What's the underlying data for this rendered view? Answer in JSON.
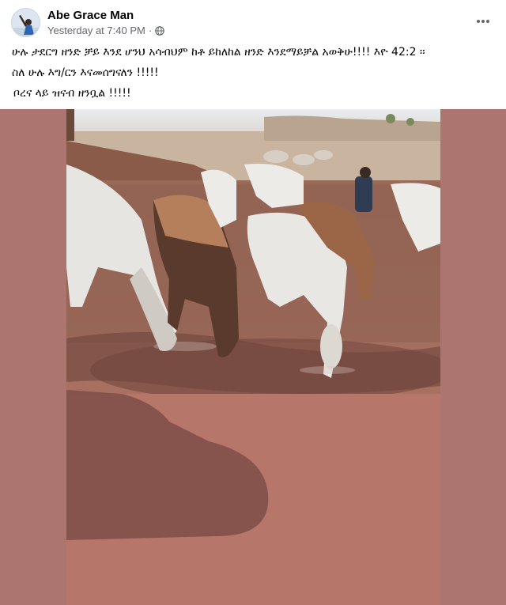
{
  "post": {
    "author": "Abe Grace Man",
    "timestamp": "Yesterday at 7:40 PM",
    "separator": "·",
    "privacy_icon": "globe-icon",
    "more_icon": "more-horizontal-icon",
    "text_lines": [
      "ሁሉ ታደርግ ዘንድ ቻይ እንደ ሆንህ አሳብህም ከቶ ይከለከል ዘንድ እንደማይቻል  አወቅሁ!!!!  እዮ 42:2  ፡፡",
      "ስለ ሁሉ እግ/ርን እናመሰግናለን !!!!!",
      "ቦረና ላይ ዝናብ ዘንቧል !!!!!"
    ]
  },
  "media": {
    "background_color": "#ac7570",
    "photo_subject": "cattle-drinking-at-puddle"
  }
}
